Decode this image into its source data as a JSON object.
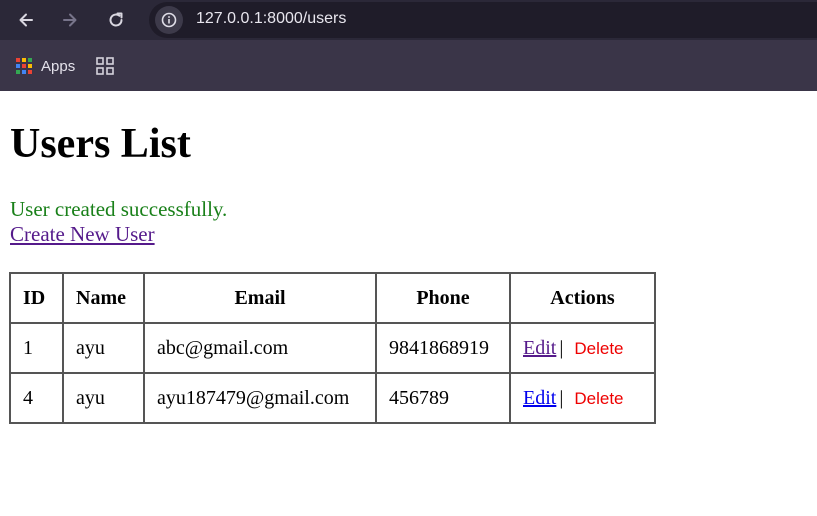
{
  "browser": {
    "url": "127.0.0.1:8000/users",
    "bookmarks": {
      "apps_label": "Apps"
    },
    "icons": {
      "back": "arrow-left-icon",
      "forward": "arrow-right-icon",
      "reload": "reload-icon",
      "site_info": "info-icon",
      "apps": "apps-grid-icon",
      "tab_groups": "grid-icon"
    }
  },
  "page": {
    "title": "Users List",
    "success_message": "User created successfully.",
    "create_link": "Create New User",
    "table": {
      "headers": [
        "ID",
        "Name",
        "Email",
        "Phone",
        "Actions"
      ],
      "rows": [
        {
          "id": "1",
          "name": "ayu",
          "email": "abc@gmail.com",
          "phone": "9841868919",
          "edit": "Edit",
          "separator": "|",
          "delete": "Delete"
        },
        {
          "id": "4",
          "name": "ayu",
          "email": "ayu187479@gmail.com",
          "phone": "456789",
          "edit": "Edit",
          "separator": "|",
          "delete": "Delete"
        }
      ]
    }
  },
  "colors": {
    "success": "#198019",
    "link_visited": "#551a8b",
    "link": "#0000ee",
    "delete": "#ee0000"
  }
}
